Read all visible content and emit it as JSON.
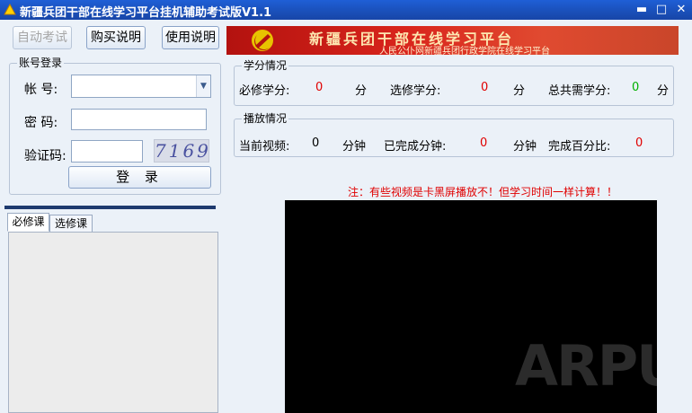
{
  "window": {
    "title": "新疆兵团干部在线学习平台挂机辅助考试版V1.1",
    "minimize_glyph": "▬",
    "maximize_glyph": "□",
    "close_glyph": "✕"
  },
  "toolbar": {
    "auto_exam_label": "自动考试",
    "buy_label": "购买说明",
    "help_label": "使用说明"
  },
  "banner": {
    "title": "新疆兵团干部在线学习平台",
    "subtitle": "人民公仆网新疆兵团行政学院在线学习平台"
  },
  "login": {
    "group_title": "账号登录",
    "account_label": "帐  号:",
    "account_value": "",
    "password_label": "密  码:",
    "password_value": "",
    "captcha_label": "验证码:",
    "captcha_value": "",
    "captcha_image_text": "7169",
    "login_button": "登 录"
  },
  "credits": {
    "group_title": "学分情况",
    "required_label": "必修学分:",
    "required_value": "0",
    "required_unit": "分",
    "elective_label": "选修学分:",
    "elective_value": "0",
    "elective_unit": "分",
    "total_label": "总共需学分:",
    "total_value": "0",
    "total_unit": "分"
  },
  "playback": {
    "group_title": "播放情况",
    "current_label": "当前视频:",
    "current_value": "0",
    "current_unit": "分钟",
    "done_label": "已完成分钟:",
    "done_value": "0",
    "done_unit": "分钟",
    "percent_label": "完成百分比:",
    "percent_value": "0"
  },
  "note": "注：有些视频是卡黑屏播放不！但学习时间一样计算！！",
  "tabs": [
    "必修课",
    "选修课"
  ],
  "watermark": "ARPUN",
  "colors": {
    "titlebar": "#1a4fb8",
    "client_bg": "#ebf1f8",
    "value_red": "#e00000",
    "value_green": "#00b000",
    "banner_red": "#d9251c"
  }
}
